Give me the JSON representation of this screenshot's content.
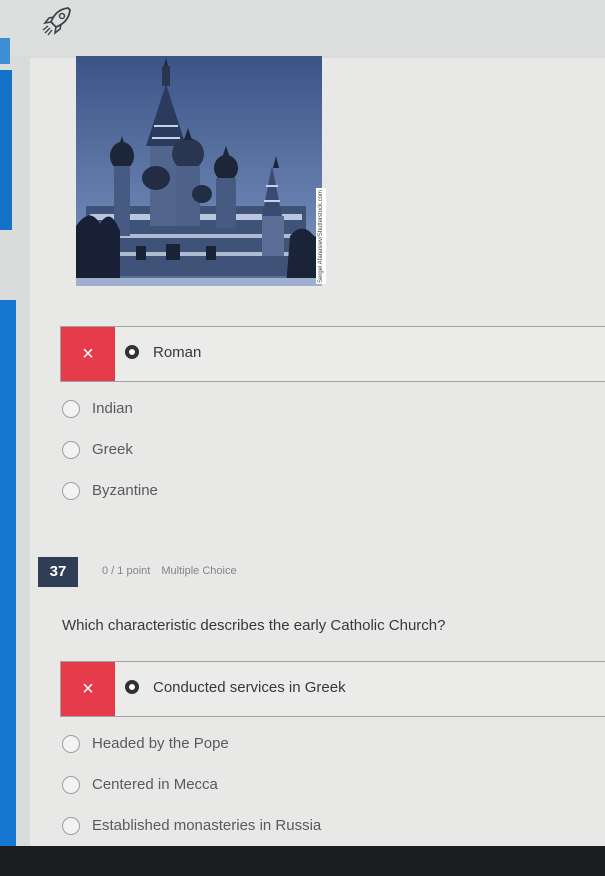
{
  "q36": {
    "selected_answer": "Roman",
    "selected_mark": "×",
    "options": [
      "Indian",
      "Greek",
      "Byzantine"
    ],
    "photo_credit": "Sergei Afanasiev/Shutterstock.com"
  },
  "q37": {
    "number": "37",
    "points": "0 / 1 point",
    "type": "Multiple Choice",
    "question": "Which characteristic describes the early Catholic Church?",
    "selected_answer": "Conducted services in Greek",
    "selected_mark": "×",
    "options": [
      "Headed by the Pope",
      "Centered in Mecca",
      "Established monasteries in Russia"
    ]
  },
  "colors": {
    "wrong_red": "#e53b4b",
    "nav_blue": "#1677d0",
    "badge_navy": "#2f3d56"
  }
}
